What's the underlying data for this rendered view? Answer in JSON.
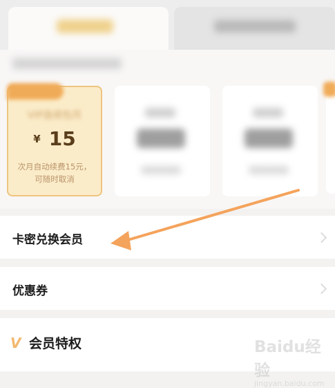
{
  "plans": {
    "selected": {
      "name": "VIP连续包月",
      "currency": "¥",
      "price": "15",
      "note_line1": "次月自动续费15元，",
      "note_line2": "可随时取消"
    }
  },
  "rows": [
    {
      "label": "卡密兑换会员"
    },
    {
      "label": "优惠券"
    },
    {
      "label": "会员特权"
    }
  ],
  "watermark": {
    "logo": "Baidu经验",
    "url": "jingyan.baidu.com"
  },
  "colors": {
    "accent_gold": "#efcf86",
    "card_selected_bg": "#fbecc9",
    "card_selected_border": "#eec47f",
    "badge_orange": "#f0ab58",
    "arrow_orange": "#f4a35c"
  }
}
